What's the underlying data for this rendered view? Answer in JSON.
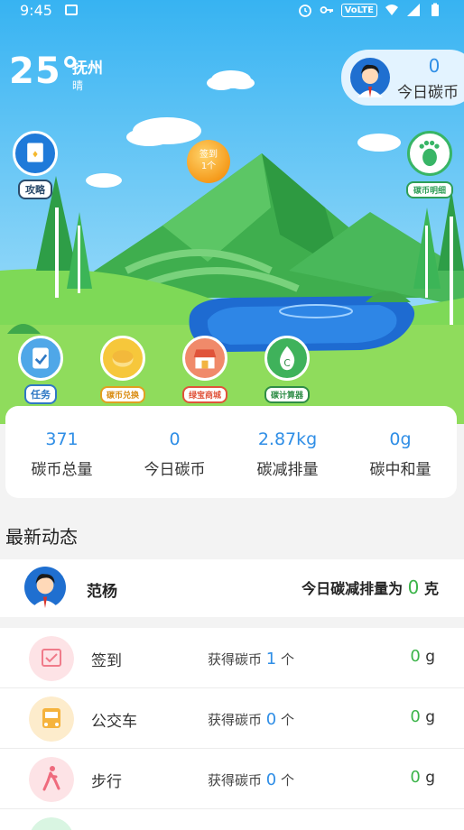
{
  "status_bar": {
    "time": "9:45",
    "network": "VoLTE"
  },
  "weather": {
    "temp": "25°",
    "city": "抚州",
    "condition": "晴"
  },
  "today_coin": {
    "value": "0",
    "label": "今日碳币"
  },
  "side_buttons": {
    "guide": "攻略",
    "coin_detail": "碳币明细"
  },
  "checkin_bubble": {
    "label": "签到",
    "count": "1个"
  },
  "actions": [
    {
      "label": "任务",
      "icon": "clipboard-check-icon"
    },
    {
      "label": "碳币兑换",
      "icon": "coin-exchange-icon"
    },
    {
      "label": "绿宝商城",
      "icon": "shop-icon"
    },
    {
      "label": "碳计算器",
      "icon": "flame-calculator-icon"
    }
  ],
  "stats": [
    {
      "value": "371",
      "label": "碳币总量"
    },
    {
      "value": "0",
      "label": "今日碳币"
    },
    {
      "value": "2.87kg",
      "label": "碳减排量"
    },
    {
      "value": "0g",
      "label": "碳中和量"
    }
  ],
  "section_title": "最新动态",
  "user": {
    "name": "范杨",
    "summary_prefix": "今日碳减排量为",
    "summary_value": "0",
    "summary_unit": "克"
  },
  "activities": [
    {
      "name": "签到",
      "earn_prefix": "获得碳币",
      "earn_value": "1",
      "earn_unit": "个",
      "gram_value": "0",
      "gram_unit": "g",
      "icon": "calendar-check-icon",
      "icon_color": "#fde3e6"
    },
    {
      "name": "公交车",
      "earn_prefix": "获得碳币",
      "earn_value": "0",
      "earn_unit": "个",
      "gram_value": "0",
      "gram_unit": "g",
      "icon": "bus-icon",
      "icon_color": "#fdeccc"
    },
    {
      "name": "步行",
      "earn_prefix": "获得碳币",
      "earn_value": "0",
      "earn_unit": "个",
      "gram_value": "0",
      "gram_unit": "g",
      "icon": "walk-icon",
      "icon_color": "#fde3e6"
    }
  ]
}
